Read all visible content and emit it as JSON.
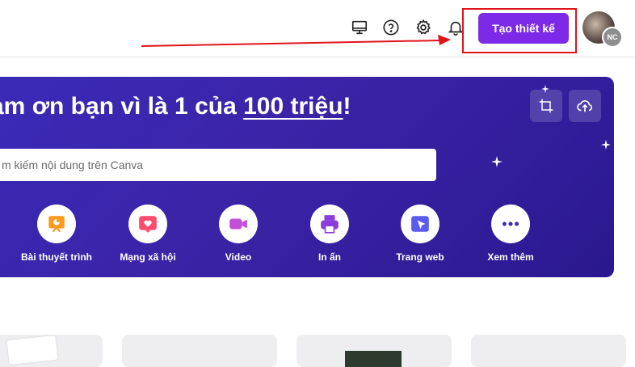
{
  "topbar": {
    "create_button": "Tạo thiết kế",
    "avatar_initials": "NC",
    "icons": [
      "monitor-icon",
      "help-icon",
      "gear-icon",
      "bell-icon"
    ]
  },
  "hero": {
    "title_prefix": "ảm ơn bạn vì là 1 của ",
    "title_highlight": "100 triệu",
    "title_suffix": "!",
    "search_placeholder": "m kiếm nội dung trên Canva",
    "categories": [
      {
        "label": "Bài thuyết trình",
        "icon": "presentation-icon",
        "color": "#ff9a1f"
      },
      {
        "label": "Mạng xã hội",
        "icon": "heart-icon",
        "color": "#ff4b6e"
      },
      {
        "label": "Video",
        "icon": "video-icon",
        "color": "#b34bd6"
      },
      {
        "label": "In ấn",
        "icon": "printer-icon",
        "color": "#8b3ddb"
      },
      {
        "label": "Trang web",
        "icon": "website-icon",
        "color": "#5a5bf0"
      },
      {
        "label": "Xem thêm",
        "icon": "more-icon",
        "color": "#3a2bb8"
      }
    ]
  },
  "colors": {
    "accent": "#7d2ae8",
    "hero_bg": "#3a2bb8",
    "highlight_box": "#e0141b"
  }
}
